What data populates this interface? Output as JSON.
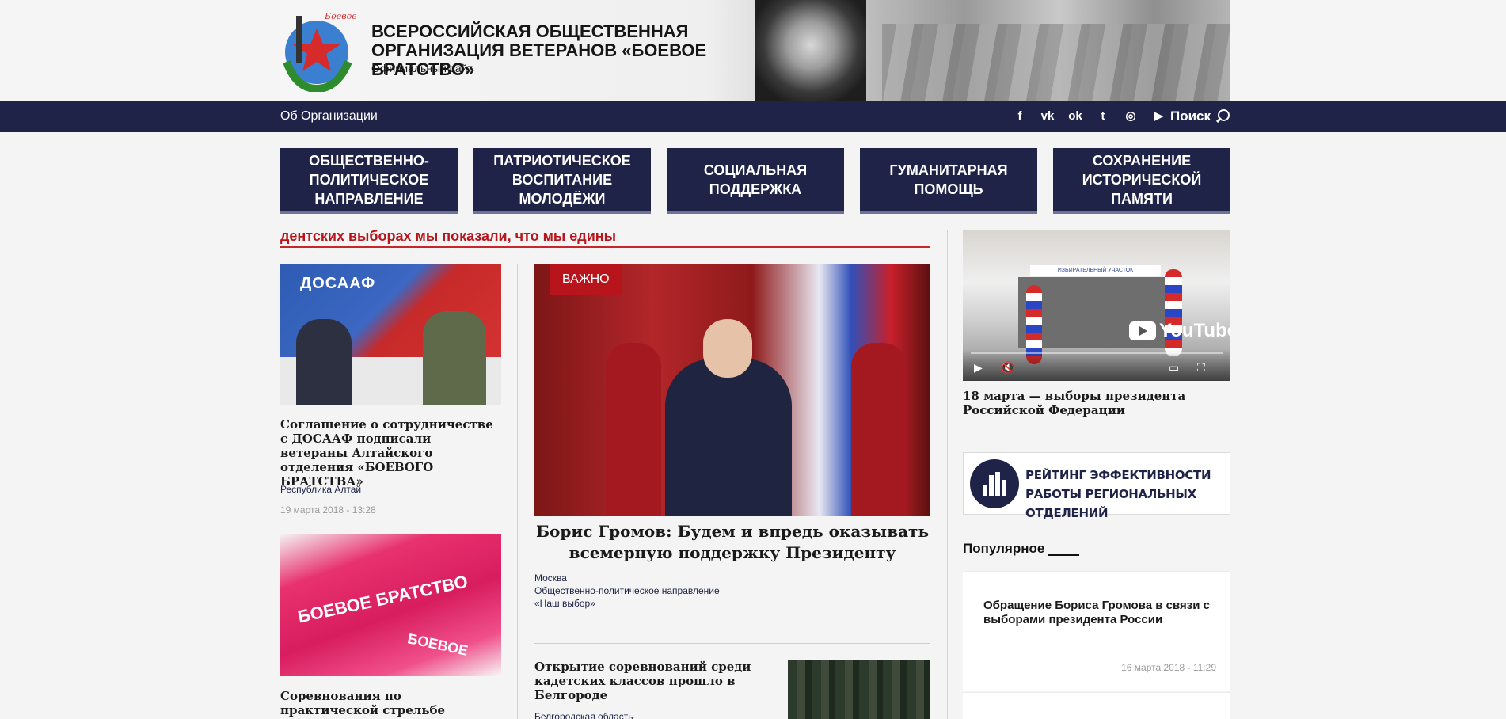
{
  "header": {
    "logo_text": "Боевое братство",
    "title_line1": "ВСЕРОССИЙСКАЯ ОБЩЕСТВЕННАЯ",
    "title_line2": "ОРГАНИЗАЦИЯ ВЕТЕРАНОВ «БОЕВОЕ БРАТСТВО»",
    "subtitle": "Официальный сайт"
  },
  "nav": {
    "about": "Об Организации",
    "social": [
      {
        "icon": "facebook-icon",
        "glyph": "f"
      },
      {
        "icon": "vk-icon",
        "glyph": "vk"
      },
      {
        "icon": "odnoklassniki-icon",
        "glyph": "ok"
      },
      {
        "icon": "twitter-icon",
        "glyph": "t"
      },
      {
        "icon": "instagram-icon",
        "glyph": "◎"
      },
      {
        "icon": "youtube-icon",
        "glyph": "▶"
      }
    ],
    "search_label": "Поиск"
  },
  "categories": [
    "ОБЩЕСТВЕННО-ПОЛИТИЧЕСКОЕ НАПРАВЛЕНИЕ",
    "ПАТРИОТИЧЕСКОЕ ВОСПИТАНИЕ МОЛОДЁЖИ",
    "СОЦИАЛЬНАЯ ПОДДЕРЖКА",
    "ГУМАНИТАРНАЯ ПОМОЩЬ",
    "СОХРАНЕНИЕ ИСТОРИЧЕСКОЙ ПАМЯТИ"
  ],
  "ticker": "дентских выборах мы показали, что мы едины",
  "left_articles": [
    {
      "image_text": "ДОСААФ",
      "title": "Соглашение о сотрудничестве с ДОСААФ подписали ветераны Алтайского отделения «БОЕВОГО БРАТСТВА»",
      "region": "Республика Алтай",
      "date": "19 марта 2018 - 13:28"
    },
    {
      "image_text": "БОЕВОЕ БРАТСТВО",
      "image_text2": "БОЕВОЕ",
      "title": "Соревнования по практической стрельбе прошли в Новосибирске"
    }
  ],
  "feature": {
    "badge": "ВАЖНО",
    "title": "Борис Громов: Будем и впредь оказывать всемерную поддержку Президенту",
    "region": "Москва",
    "category": "Общественно-политическое направление",
    "tag": "«Наш выбор»"
  },
  "second_article": {
    "title": "Открытие соревнований среди кадетских классов прошло в Белгороде",
    "region": "Белгородская область"
  },
  "video": {
    "banner": "ИЗБИРАТЕЛЬНЫЙ УЧАСТОК",
    "brand": "YouTube",
    "caption": "18 марта — выборы президента Российской Федерации"
  },
  "rating": {
    "text": "РЕЙТИНГ ЭФФЕКТИВНОСТИ РАБОТЫ РЕГИОНАЛЬНЫХ ОТДЕЛЕНИЙ"
  },
  "popular": {
    "heading": "Популярное",
    "items": [
      {
        "title": "Обращение Бориса Громова в связи с выборами президента России",
        "date": "16 марта 2018 - 11:29"
      }
    ]
  }
}
